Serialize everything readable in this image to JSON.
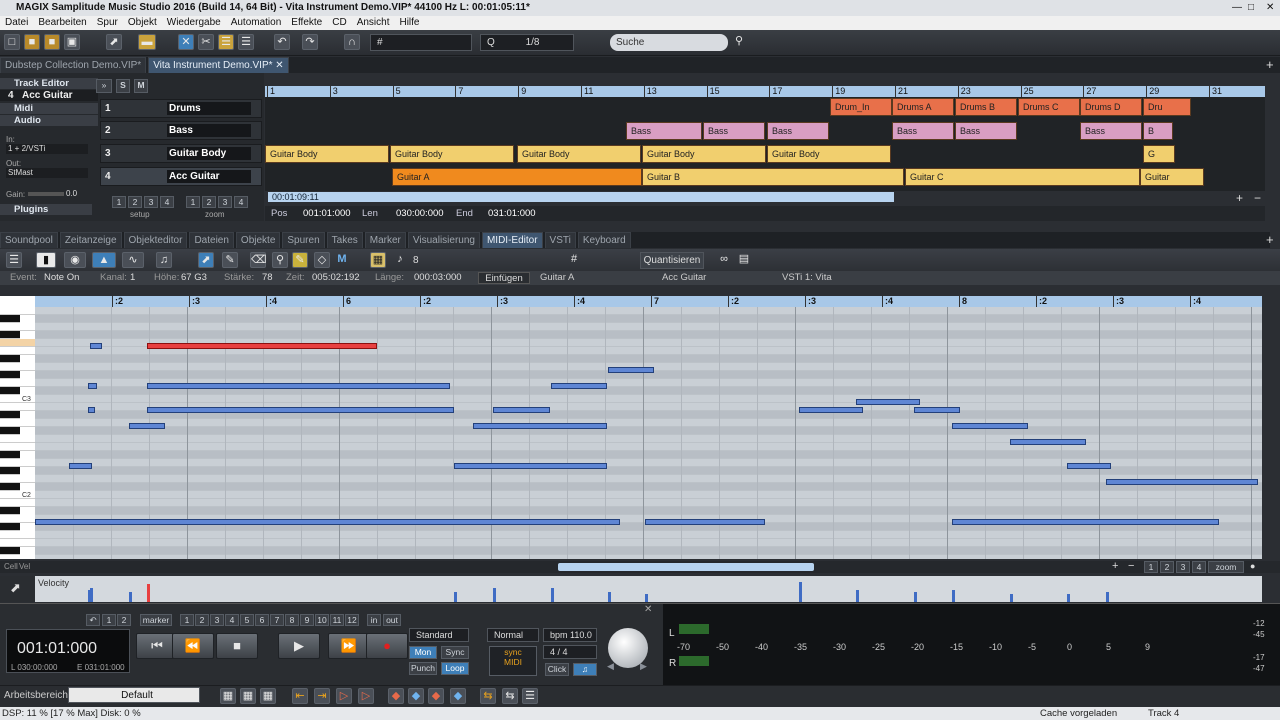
{
  "title": "MAGIX Samplitude Music Studio 2016 (Build 14, 64 Bit)  -  Vita Instrument Demo.VIP*   44100 Hz L: 00:01:05:11*",
  "menu": [
    "Datei",
    "Bearbeiten",
    "Spur",
    "Objekt",
    "Wiedergabe",
    "Automation",
    "Effekte",
    "CD",
    "Ansicht",
    "Hilfe"
  ],
  "toolbar": {
    "quant_label": "Q",
    "quant_value": "1/8",
    "search_placeholder": "Suche"
  },
  "doc_tabs": [
    "Dubstep Collection Demo.VIP*",
    "Vita Instrument Demo.VIP*"
  ],
  "left_panel": {
    "track_editor": "Track Editor",
    "track_sel_num": "4",
    "track_sel_name": "Acc Guitar",
    "midi": "Midi",
    "audio": "Audio",
    "plugins": "Plugins",
    "in_label": "In:",
    "in_value": "1 + 2/VSTi",
    "out_label": "Out:",
    "out_value": "StMast",
    "gain_label": "Gain:",
    "gain_value": "0.0",
    "setup": "setup",
    "zoom": "zoom"
  },
  "tracks": [
    {
      "num": "1",
      "name": "Drums"
    },
    {
      "num": "2",
      "name": "Bass"
    },
    {
      "num": "3",
      "name": "Guitar Body"
    },
    {
      "num": "4",
      "name": "Acc Guitar"
    }
  ],
  "ruler_marks": [
    "1",
    "3",
    "5",
    "7",
    "9",
    "11",
    "13",
    "15",
    "17",
    "19",
    "21",
    "23",
    "25",
    "27",
    "29",
    "31"
  ],
  "clips": {
    "drums": [
      "Drum_In",
      "Drums A",
      "Drums B",
      "Drums C",
      "Drums D",
      "Dru"
    ],
    "bass": [
      "Bass",
      "Bass",
      "Bass",
      "Bass",
      "Bass",
      "Bass",
      "B"
    ],
    "guitar_body": [
      "Guitar Body",
      "Guitar Body",
      "Guitar Body",
      "Guitar Body",
      "Guitar Body",
      "G"
    ],
    "acc": [
      "Guitar A",
      "Guitar B",
      "Guitar C",
      "Guitar"
    ]
  },
  "arrange_time": "00:01:09:11",
  "position": {
    "pos_label": "Pos",
    "pos": "001:01:000",
    "len_label": "Len",
    "len": "030:00:000",
    "end_label": "End",
    "end": "031:01:000"
  },
  "lower_tabs": [
    "Soundpool",
    "Zeitanzeige",
    "Objekteditor",
    "Dateien",
    "Objekte",
    "Spuren",
    "Takes",
    "Marker",
    "Visualisierung",
    "MIDI-Editor",
    "VSTi",
    "Keyboard"
  ],
  "midi_toolbar": {
    "quantize": "Quantisieren",
    "grid_num": "8"
  },
  "event": {
    "event_label": "Event:",
    "event": "Note On",
    "kanal_label": "Kanal:",
    "kanal": "1",
    "hoehe_label": "Höhe:",
    "hoehe": "67 G3",
    "staerke_label": "Stärke:",
    "staerke": "78",
    "zeit_label": "Zeit:",
    "zeit": "005:02:192",
    "laenge_label": "Länge:",
    "laenge": "000:03:000",
    "insert": "Einfügen",
    "object": "Guitar A",
    "track": "Acc Guitar",
    "vsti": "VSTi 1: Vita"
  },
  "pr_ruler": [
    ":2",
    ":3",
    ":4",
    "6",
    ":2",
    ":3",
    ":4",
    "7",
    ":2",
    ":3",
    ":4",
    "8",
    ":2",
    ":3",
    ":4"
  ],
  "key_labels": [
    "C3",
    "C2"
  ],
  "velocity_label": "Velocity",
  "cell_label": "Cell",
  "vel_label": "Vel",
  "zoom_label": "zoom",
  "zoom_nums": [
    "1",
    "2",
    "3",
    "4"
  ],
  "transport": {
    "time": "001:01:000",
    "l_label": "L",
    "l": "030:00:000",
    "e_label": "E",
    "e": "031:01:000",
    "marker": "marker",
    "markers": [
      "1",
      "2",
      "3",
      "4",
      "5",
      "6",
      "7",
      "8",
      "9",
      "10",
      "11",
      "12"
    ],
    "in": "in",
    "out": "out",
    "mode": "Standard",
    "mon": "Mon",
    "sync": "Sync",
    "punch": "Punch",
    "loop": "Loop",
    "normal": "Normal",
    "bpm": "bpm 110.0",
    "sig": "4 / 4",
    "click": "Click"
  },
  "meter_scale": [
    "-70",
    "-50",
    "-40",
    "-35",
    "-30",
    "-25",
    "-20",
    "-15",
    "-10",
    "-5",
    "0",
    "5",
    "9"
  ],
  "meter_right": [
    "-12",
    "-45",
    "-17",
    "-47"
  ],
  "bottom": {
    "workspace_label": "Arbeitsbereich:",
    "workspace": "Default"
  },
  "status": {
    "dsp": "DSP: 11 % [17 % Max]   Disk:  0 %",
    "cache": "Cache vorgeladen",
    "track": "Track 4"
  },
  "colors": {
    "drums": "#e8704a",
    "bass": "#d99ec3",
    "guitar": "#f1cf6e",
    "acc": "#f08a1e",
    "note": "#5f86d4",
    "selected_note": "#e84040"
  }
}
